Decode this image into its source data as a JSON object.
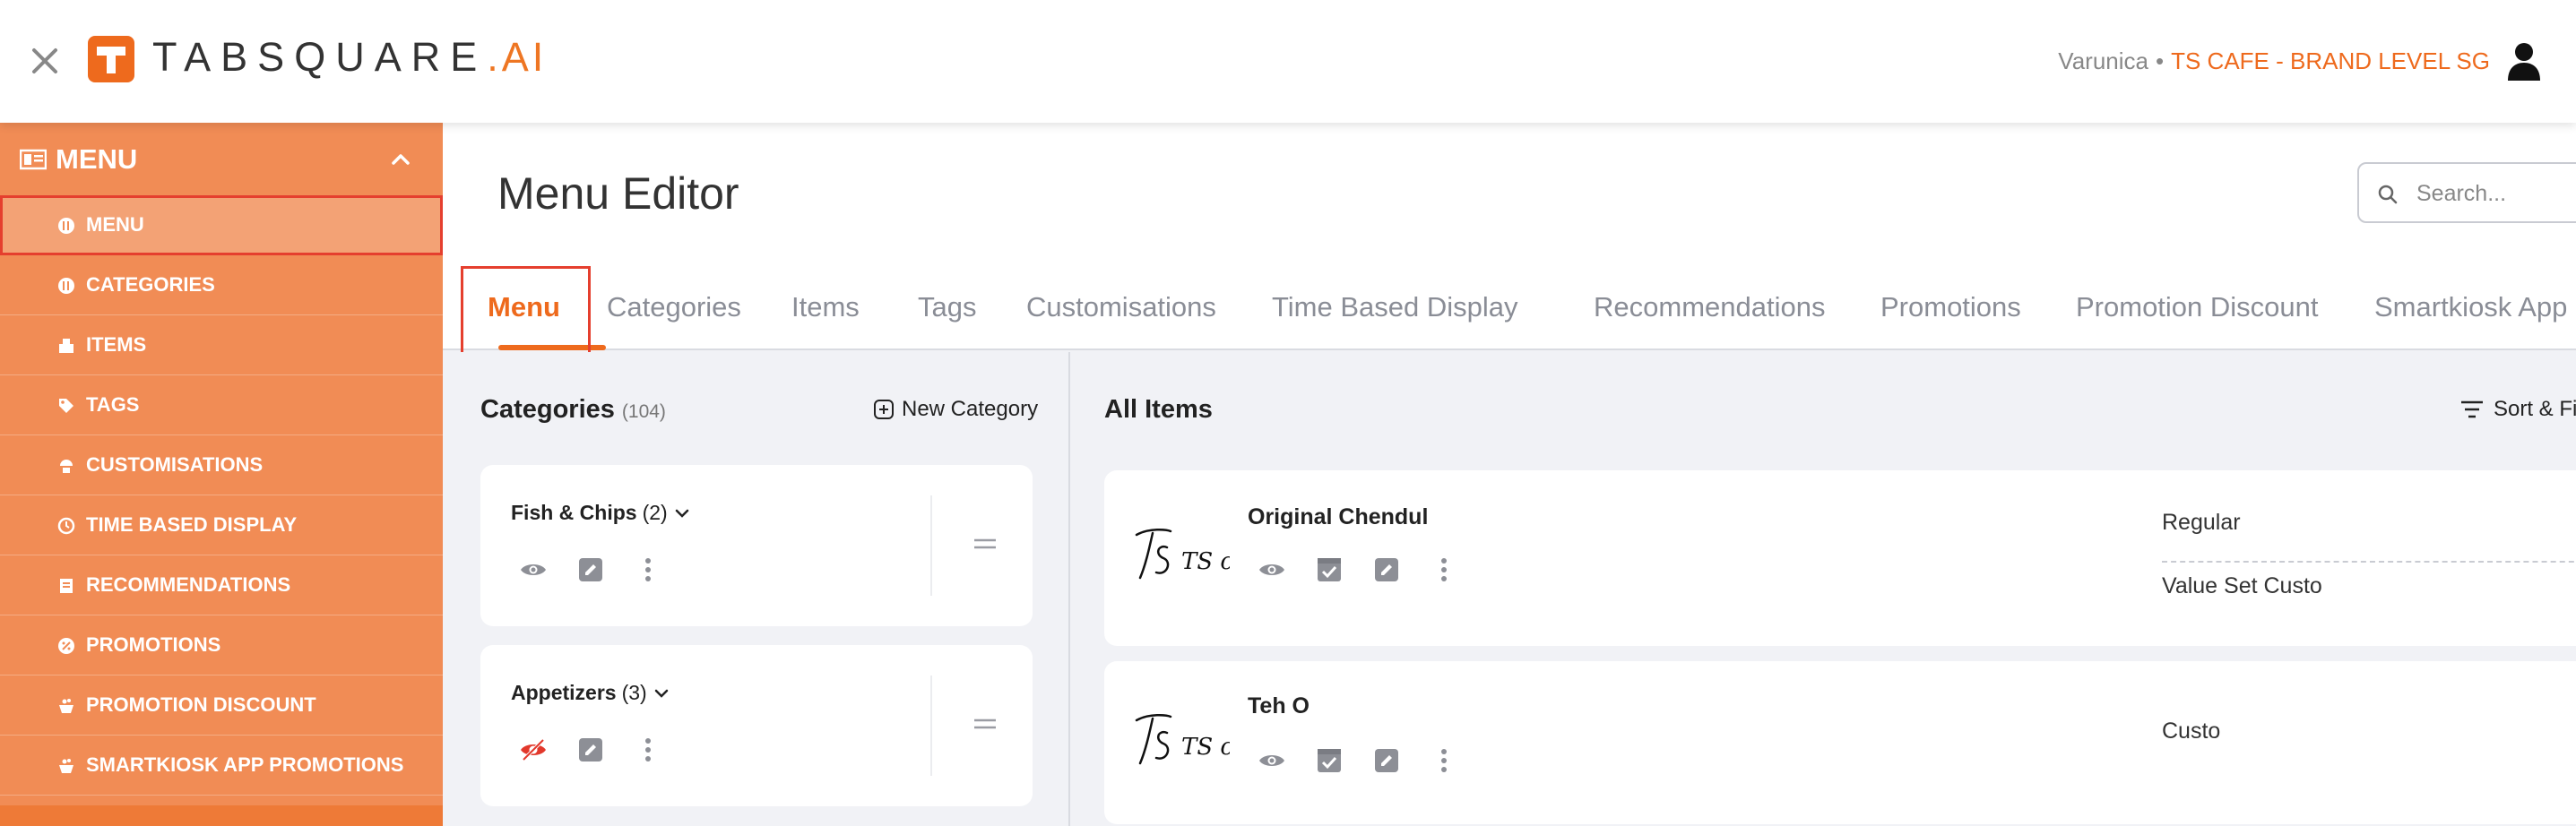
{
  "topbar": {
    "brand_main": "TABSQUARE",
    "brand_suffix": ".AI",
    "user_name": "Varunica",
    "separator": "•",
    "brand_level": "TS CAFE - BRAND LEVEL SG"
  },
  "sidebar": {
    "header": "MENU",
    "items": [
      {
        "label": "MENU",
        "icon": "menu-icon"
      },
      {
        "label": "CATEGORIES",
        "icon": "categories-icon"
      },
      {
        "label": "ITEMS",
        "icon": "items-icon"
      },
      {
        "label": "TAGS",
        "icon": "tag-icon"
      },
      {
        "label": "CUSTOMISATIONS",
        "icon": "customisations-icon"
      },
      {
        "label": "TIME BASED DISPLAY",
        "icon": "clock-icon"
      },
      {
        "label": "RECOMMENDATIONS",
        "icon": "recommendations-icon"
      },
      {
        "label": "PROMOTIONS",
        "icon": "promotions-icon"
      },
      {
        "label": "PROMOTION DISCOUNT",
        "icon": "discount-icon"
      },
      {
        "label": "SMARTKIOSK APP PROMOTIONS",
        "icon": "kiosk-icon"
      }
    ]
  },
  "page": {
    "title": "Menu Editor",
    "search_placeholder": "Search..."
  },
  "tabs": [
    "Menu",
    "Categories",
    "Items",
    "Tags",
    "Customisations",
    "Time Based Display",
    "Recommendations",
    "Promotions",
    "Promotion Discount",
    "Smartkiosk App Pr"
  ],
  "categories_panel": {
    "title": "Categories",
    "count": "(104)",
    "new_label": "New Category",
    "cards": [
      {
        "name": "Fish & Chips",
        "count": "(2)",
        "visible": true
      },
      {
        "name": "Appetizers",
        "count": "(3)",
        "visible": false
      }
    ]
  },
  "items_panel": {
    "title": "All Items",
    "sort_label": "Sort & Fi",
    "logo_text": "TS cafe",
    "items": [
      {
        "name": "Original Chendul",
        "options": [
          "Regular",
          "Value Set Custo"
        ]
      },
      {
        "name": "Teh O",
        "options": [
          "Custo"
        ]
      }
    ]
  },
  "colors": {
    "accent": "#ee6a1d",
    "sidebar": "#f18c55",
    "highlight": "#e53f2e"
  }
}
